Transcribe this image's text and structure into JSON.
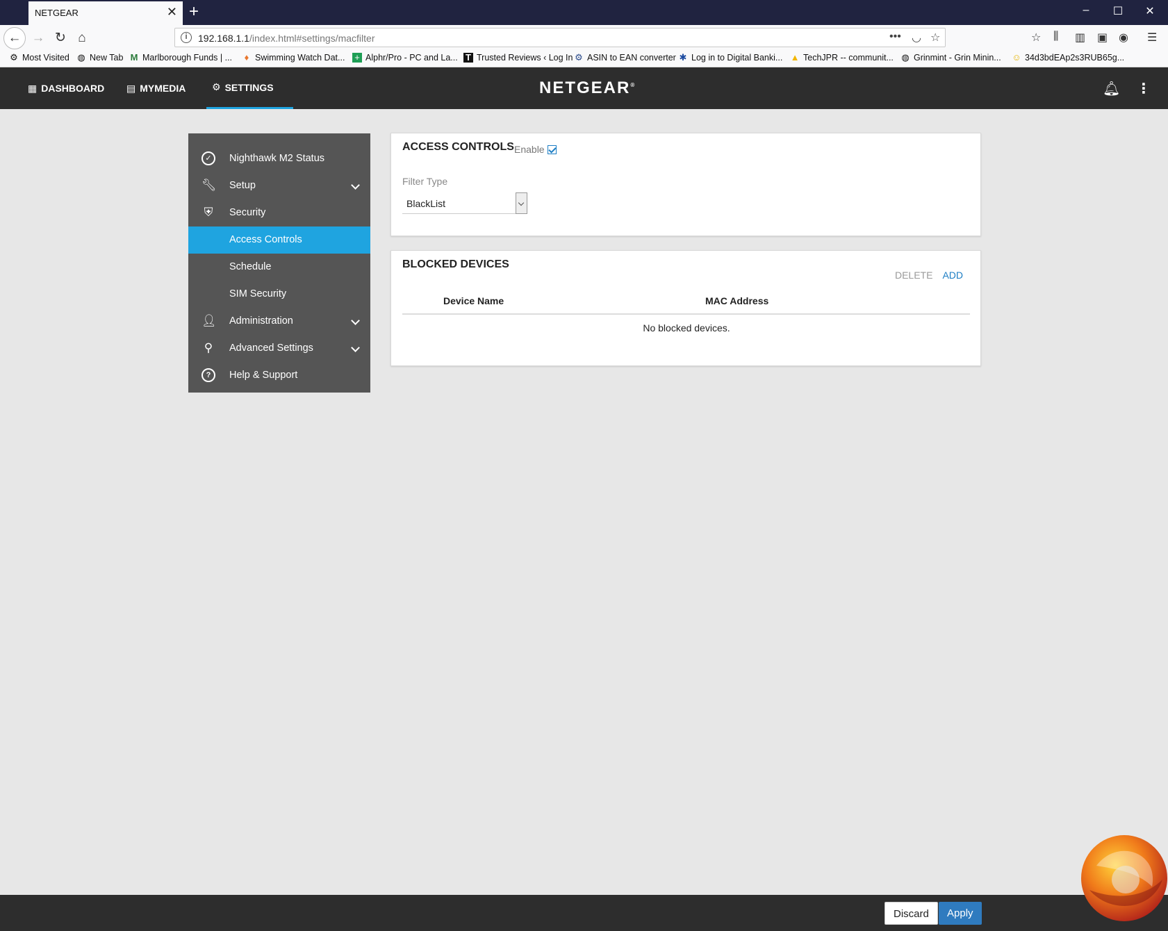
{
  "browser": {
    "tab_title": "NETGEAR",
    "url_host": "192.168.1.1",
    "url_path": "/index.html#settings/macfilter",
    "bookmarks": [
      {
        "label": "Most Visited",
        "icon": "gear-icon"
      },
      {
        "label": "New Tab",
        "icon": "globe-icon"
      },
      {
        "label": "Marlborough Funds | ...",
        "icon": "m-icon"
      },
      {
        "label": "Swimming Watch Dat...",
        "icon": "pin-icon"
      },
      {
        "label": "Alphr/Pro - PC and La...",
        "icon": "plus-icon"
      },
      {
        "label": "Trusted Reviews ‹ Log In",
        "icon": "t-icon"
      },
      {
        "label": "ASIN to EAN converter",
        "icon": "gear-icon"
      },
      {
        "label": "Log in to Digital Banki...",
        "icon": "star-icon"
      },
      {
        "label": "TechJPR -- communit...",
        "icon": "drive-icon"
      },
      {
        "label": "Grinmint - Grin Minin...",
        "icon": "globe-icon"
      },
      {
        "label": "34d3bdEAp2s3RUB65g...",
        "icon": "smiley-icon"
      }
    ]
  },
  "header": {
    "nav": [
      {
        "label": "DASHBOARD",
        "icon": "grid-icon"
      },
      {
        "label": "MYMEDIA",
        "icon": "media-icon"
      },
      {
        "label": "SETTINGS",
        "icon": "gear-icon",
        "active": true
      }
    ],
    "logo": "NETGEAR",
    "accent": "#1fa4e0"
  },
  "sidebar": {
    "items": [
      {
        "label": "Nighthawk M2 Status",
        "icon": "check-circle-icon"
      },
      {
        "label": "Setup",
        "icon": "wrench-icon",
        "expandable": true
      },
      {
        "label": "Security",
        "icon": "shield-icon"
      },
      {
        "label": "Access Controls",
        "active": true
      },
      {
        "label": "Schedule"
      },
      {
        "label": "SIM Security"
      },
      {
        "label": "Administration",
        "icon": "person-icon",
        "expandable": true
      },
      {
        "label": "Advanced Settings",
        "icon": "key-icon",
        "expandable": true
      },
      {
        "label": "Help & Support",
        "icon": "help-icon"
      }
    ]
  },
  "access_controls": {
    "title": "ACCESS CONTROLS",
    "enable_label": "Enable",
    "enabled": true,
    "filter_type_label": "Filter Type",
    "filter_type_value": "BlackList"
  },
  "blocked_devices": {
    "title": "BLOCKED DEVICES",
    "delete_label": "DELETE",
    "add_label": "ADD",
    "columns": [
      "Device Name",
      "MAC Address"
    ],
    "empty_message": "No blocked devices."
  },
  "footer": {
    "discard_label": "Discard",
    "apply_label": "Apply"
  }
}
